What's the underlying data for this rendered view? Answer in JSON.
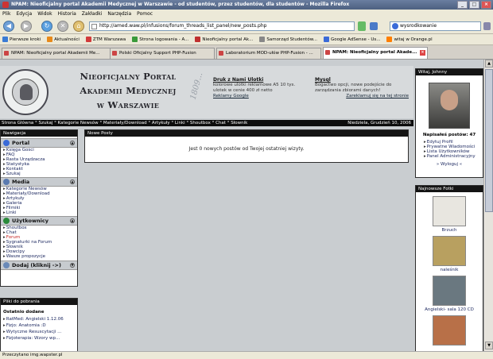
{
  "window": {
    "title": "NPAM: Nieoficjalny portal Akademii Medycznej w Warszawie - od studentów, przez studentów, dla studentów - Mozilla Firefox"
  },
  "menu": [
    "Plik",
    "Edycja",
    "Widok",
    "Historia",
    "Zakładki",
    "Narzędzia",
    "Pomoc"
  ],
  "nav": {
    "url": "http://amed.waw.pl/infusions/forum_threads_list_panel/new_posts.php",
    "search_value": "wysrodkowanie"
  },
  "bookmarks": [
    {
      "label": "Pierwsze kroki",
      "color": "#3a7bd5"
    },
    {
      "label": "Aktualności",
      "color": "#e88a1a"
    },
    {
      "label": "ZTM Warszawa",
      "color": "#d23a3a"
    },
    {
      "label": "Strona logowania - A...",
      "color": "#3a9a3a"
    },
    {
      "label": "Nieoficjalny portal Ak...",
      "color": "#c03030"
    },
    {
      "label": "Samorząd Studentów...",
      "color": "#888888"
    },
    {
      "label": "Google AdSense - Us...",
      "color": "#3a6ad8"
    },
    {
      "label": "witaj w Orange.pl",
      "color": "#ff7f00"
    }
  ],
  "tabs": [
    {
      "label": "NPAM: Nieoficjalny portal Akademii Me...",
      "active": false
    },
    {
      "label": "Polski Oficjalny Support PHP-Fusion",
      "active": false
    },
    {
      "label": "Laboratorium MOD-ułów PHP-Fusion - ...",
      "active": false
    },
    {
      "label": "NPAM: Nieoficjalny portal Akade...",
      "active": true
    }
  ],
  "header": {
    "title_lines": [
      "Nieoficjalny Portal",
      "Akademii Medycznej",
      "w Warszawie"
    ],
    "year": "1809...",
    "ad1": {
      "title": "Druk z Nami Ulotki",
      "text": "kolorowe ulotki reklamowe A5 10 tys. ulotek w cenie 400 zł netto",
      "link": "Reklamy Google"
    },
    "ad2": {
      "title": "Mysql",
      "text": "Bogactwo opcji, nowe podejście do zarządzania zbiorami danych!",
      "link": "Zareklamuj się na tej stronie"
    }
  },
  "menustrip": {
    "items": "Strona Główna ° Szukaj ° Kategorie Newsów ° Materiały/Download ° Artykuły ° Linki ° Shoutbox ° Chat ° Słownik",
    "date": "Niedziela, Grudzień 10, 2006"
  },
  "nav_panel": {
    "title": "Nawigacja",
    "sections": [
      {
        "name": "Portal",
        "icon_color": "#3a6ad8",
        "links": [
          {
            "t": "Księga Gości"
          },
          {
            "t": "FAQ"
          },
          {
            "t": "Rasta Urządzacza"
          },
          {
            "t": "Statystyka"
          },
          {
            "t": "Kontakt"
          },
          {
            "t": "Szukaj"
          }
        ]
      },
      {
        "name": "Media",
        "icon_color": "#5a7ab0",
        "links": [
          {
            "t": "Kategorie Newsów"
          },
          {
            "t": "Materiały/Download"
          },
          {
            "t": "Artykuły"
          },
          {
            "t": "Galeria"
          },
          {
            "t": "Filmiki"
          },
          {
            "t": "Linki"
          }
        ]
      },
      {
        "name": "Użytkownicy",
        "icon_color": "#2a8a3a",
        "links": [
          {
            "t": "Shoutbox"
          },
          {
            "t": "Chat"
          },
          {
            "t": "Forum",
            "red": true
          },
          {
            "t": "Sygnaturki na Forum"
          },
          {
            "t": "Słownik"
          },
          {
            "t": "Dowcipy"
          },
          {
            "t": "Wasze propozycje"
          }
        ]
      }
    ],
    "dodaj": "Dodaj (kliknij ->)"
  },
  "downloads_panel": {
    "title": "Pliki do pobrania",
    "subtitle": "Ostatnio dodane",
    "items": [
      "RatMed: Angielski 1.12.06",
      "Fizjo: Anatomia :D",
      "Wytyczne Resuscytacji ...",
      "Fizjoterapia: Wzory wp..."
    ]
  },
  "main": {
    "panel_title": "Nowe Posty",
    "message": "Jest 0 nowych postów od Twojej ostatniej wizyty."
  },
  "user_panel": {
    "title": "Witaj, Johnny",
    "posts": "Napisałeś postów: 47",
    "links": [
      "Edytuj Profil",
      "Prywatne Wiadomości",
      "Lista Użytkowników",
      "Panel Administracyjny"
    ],
    "logout": "Wyloguj"
  },
  "photos_panel": {
    "title": "Najnowsze Fotki",
    "photos": [
      {
        "caption": "Brzuch",
        "color": "#e8e6e0"
      },
      {
        "caption": "naleśnik",
        "color": "#b8a060"
      },
      {
        "caption": "Angielski- sala 120 CD",
        "color": "#6a7880"
      },
      {
        "caption": "",
        "color": "#b87048"
      }
    ]
  },
  "status": "Przeczytano img.wapster.pl"
}
